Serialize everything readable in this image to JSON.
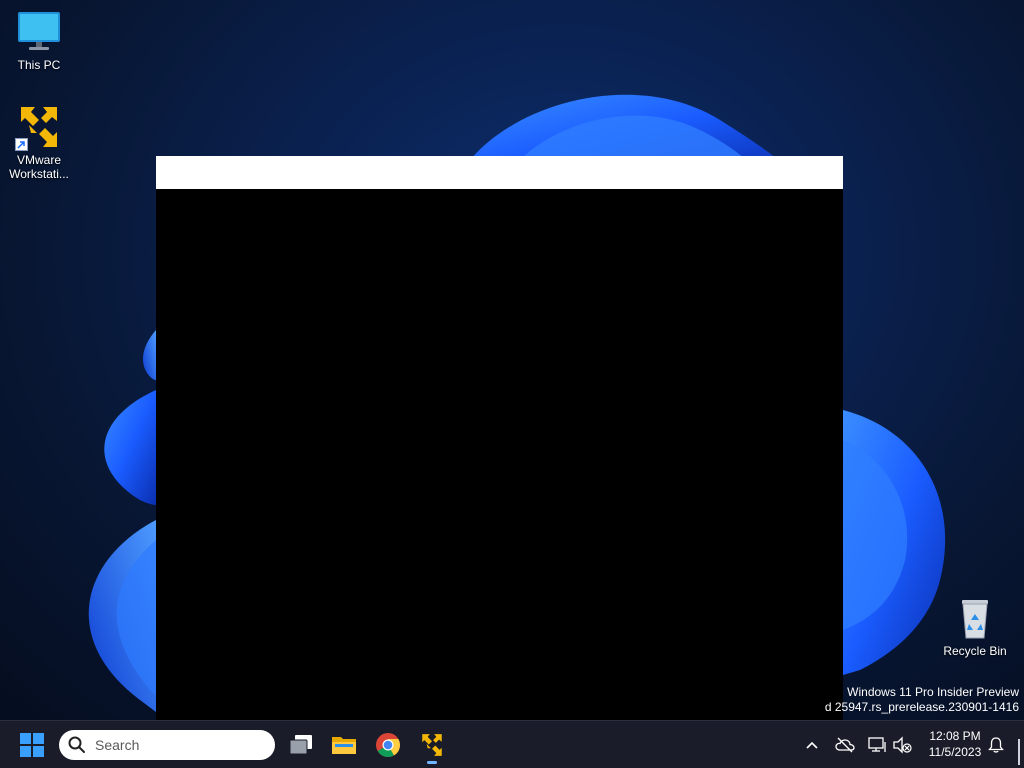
{
  "desktop": {
    "icons": [
      {
        "label": "This PC",
        "icon": "monitor-icon"
      },
      {
        "label": "VMware Workstati...",
        "icon": "vmware-icon"
      },
      {
        "label": "Recycle Bin",
        "icon": "recycle-bin-icon"
      }
    ],
    "watermark": {
      "edition": "Windows 11 Pro Insider Preview",
      "build": "d 25947.rs_prerelease.230901-1416"
    }
  },
  "taskbar": {
    "search_placeholder": "Search",
    "apps": [
      {
        "name": "Task View",
        "icon": "task-view-icon"
      },
      {
        "name": "File Explorer",
        "icon": "folder-icon"
      },
      {
        "name": "Google Chrome",
        "icon": "chrome-icon"
      },
      {
        "name": "VMware Workstation",
        "icon": "vmware-icon"
      }
    ],
    "clock": {
      "time": "12:08 PM",
      "date": "11/5/2023"
    }
  },
  "colors": {
    "taskbar_bg": "#1a1d29",
    "accent_blue": "#1a6cff",
    "vmware_yellow": "#f2b707",
    "window_title_bg": "#ffffff",
    "window_content_bg": "#000000"
  }
}
